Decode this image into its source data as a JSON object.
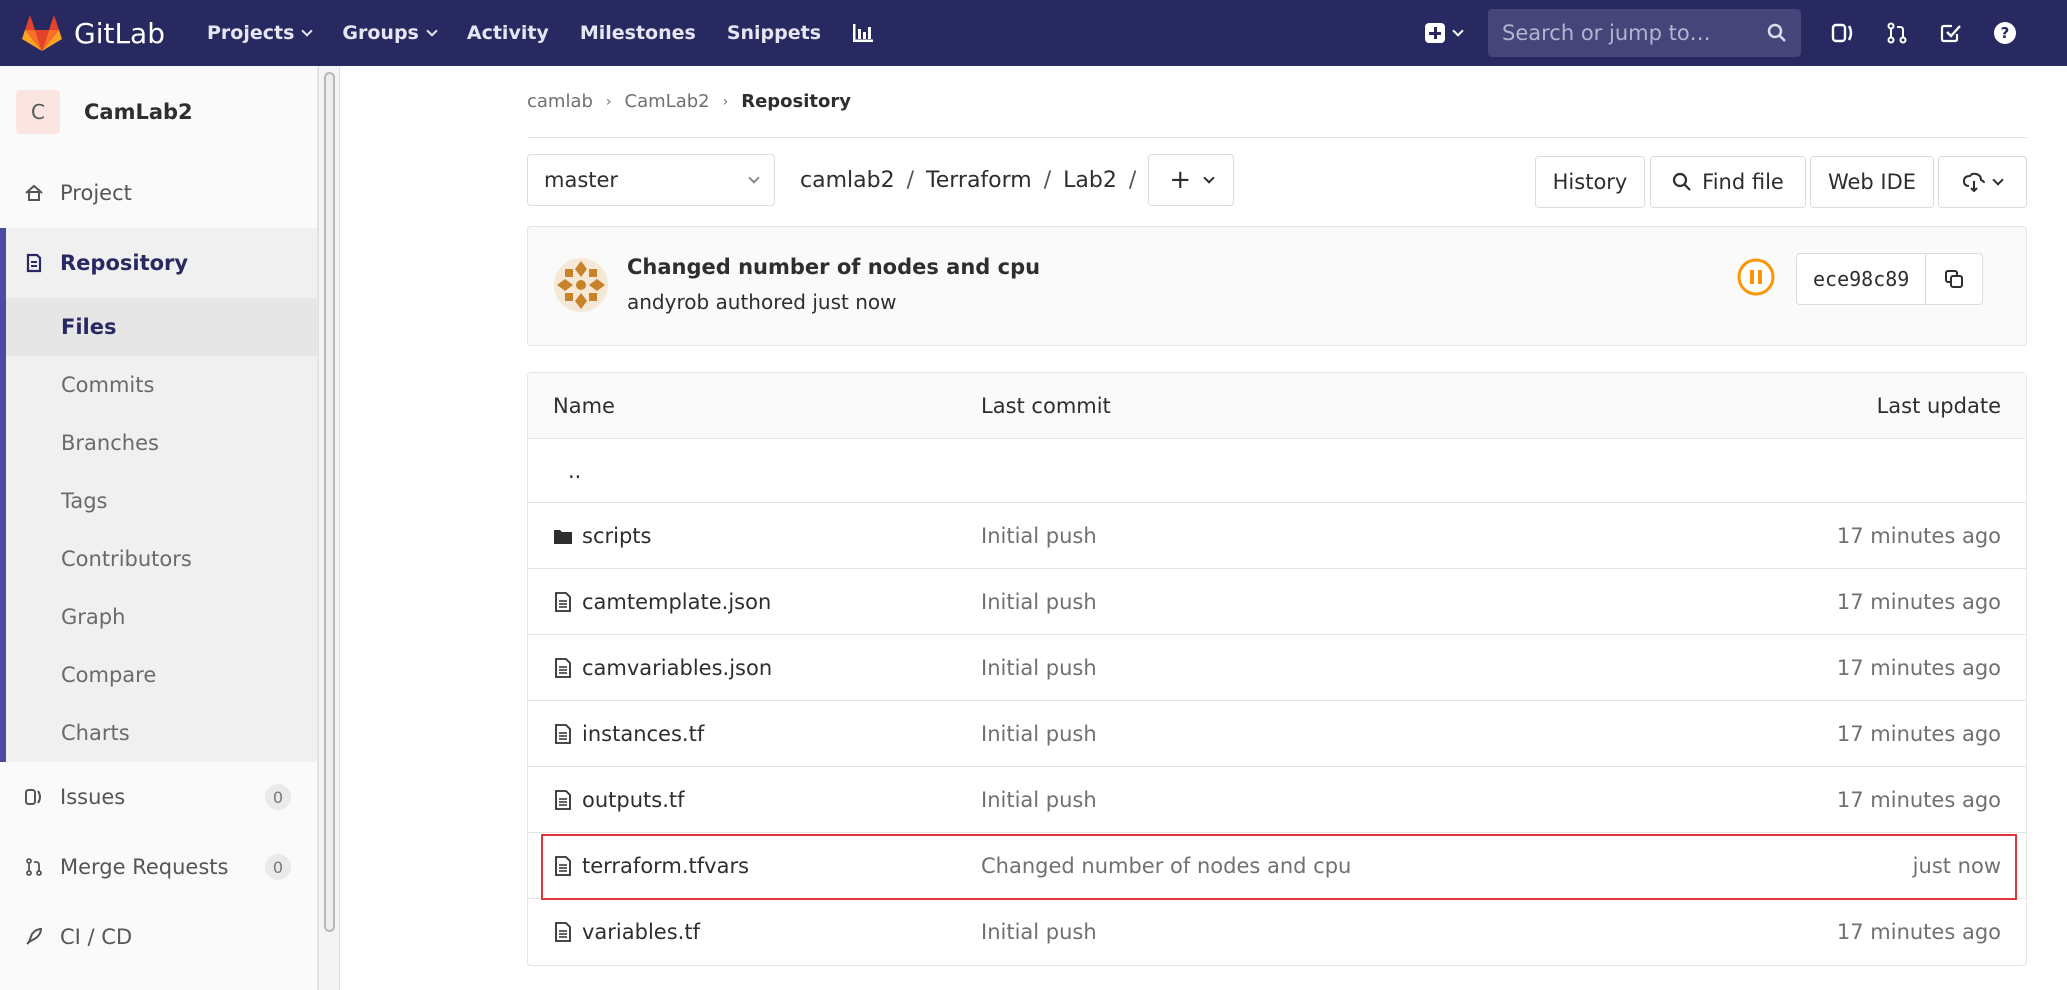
{
  "navbar": {
    "brand": "GitLab",
    "links": [
      {
        "label": "Projects",
        "dropdown": true
      },
      {
        "label": "Groups",
        "dropdown": true
      },
      {
        "label": "Activity",
        "dropdown": false
      },
      {
        "label": "Milestones",
        "dropdown": false
      },
      {
        "label": "Snippets",
        "dropdown": false
      }
    ],
    "search_placeholder": "Search or jump to…",
    "colors": {
      "bg": "#292961",
      "accent": "#fc6d26"
    }
  },
  "sidebar": {
    "project_initial": "C",
    "project_name": "CamLab2",
    "project_label": "Project",
    "repository_label": "Repository",
    "repo_items": [
      "Files",
      "Commits",
      "Branches",
      "Tags",
      "Contributors",
      "Graph",
      "Compare",
      "Charts"
    ],
    "issues_label": "Issues",
    "issues_count": "0",
    "mr_label": "Merge Requests",
    "mr_count": "0",
    "cicd_label": "CI / CD"
  },
  "breadcrumb": {
    "items": [
      "camlab",
      "CamLab2"
    ],
    "current": "Repository"
  },
  "tree": {
    "branch": "master",
    "path": [
      "camlab2",
      "Terraform",
      "Lab2"
    ],
    "add_label": "+",
    "history_label": "History",
    "find_file_label": "Find file",
    "web_ide_label": "Web IDE"
  },
  "commit": {
    "title": "Changed number of nodes and cpu",
    "meta": "andyrob authored just now",
    "sha": "ece98c89",
    "pipeline_color": "#fc9403"
  },
  "files": {
    "headers": {
      "name": "Name",
      "last_commit": "Last commit",
      "last_update": "Last update"
    },
    "parent": "..",
    "rows": [
      {
        "name": "scripts",
        "type": "folder",
        "commit": "Initial push",
        "updated": "17 minutes ago"
      },
      {
        "name": "camtemplate.json",
        "type": "file",
        "commit": "Initial push",
        "updated": "17 minutes ago"
      },
      {
        "name": "camvariables.json",
        "type": "file",
        "commit": "Initial push",
        "updated": "17 minutes ago"
      },
      {
        "name": "instances.tf",
        "type": "file",
        "commit": "Initial push",
        "updated": "17 minutes ago"
      },
      {
        "name": "outputs.tf",
        "type": "file",
        "commit": "Initial push",
        "updated": "17 minutes ago"
      },
      {
        "name": "terraform.tfvars",
        "type": "file",
        "commit": "Changed number of nodes and cpu",
        "updated": "just now",
        "highlighted": true
      },
      {
        "name": "variables.tf",
        "type": "file",
        "commit": "Initial push",
        "updated": "17 minutes ago"
      }
    ]
  }
}
